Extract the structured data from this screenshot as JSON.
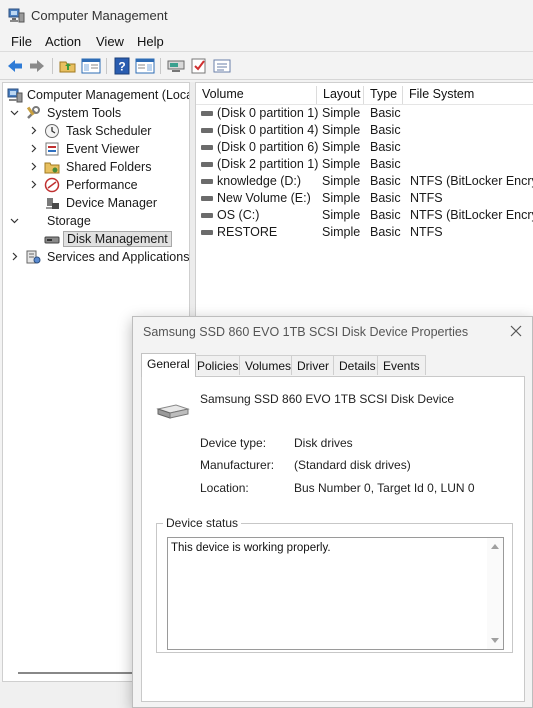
{
  "window": {
    "title": "Computer Management",
    "menu": [
      "File",
      "Action",
      "View",
      "Help"
    ]
  },
  "tree": {
    "root": "Computer Management (Local",
    "system_tools": "System Tools",
    "task_scheduler": "Task Scheduler",
    "event_viewer": "Event Viewer",
    "shared_folders": "Shared Folders",
    "performance": "Performance",
    "device_manager": "Device Manager",
    "storage": "Storage",
    "disk_management": "Disk Management",
    "services_apps": "Services and Applications"
  },
  "volumes": {
    "columns": [
      "Volume",
      "Layout",
      "Type",
      "File System"
    ],
    "rows": [
      {
        "volume": "(Disk 0 partition 1)",
        "layout": "Simple",
        "type": "Basic",
        "fs": ""
      },
      {
        "volume": "(Disk 0 partition 4)",
        "layout": "Simple",
        "type": "Basic",
        "fs": ""
      },
      {
        "volume": "(Disk 0 partition 6)",
        "layout": "Simple",
        "type": "Basic",
        "fs": ""
      },
      {
        "volume": "(Disk 2 partition 1)",
        "layout": "Simple",
        "type": "Basic",
        "fs": ""
      },
      {
        "volume": "knowledge (D:)",
        "layout": "Simple",
        "type": "Basic",
        "fs": "NTFS (BitLocker Encrypt"
      },
      {
        "volume": "New Volume (E:)",
        "layout": "Simple",
        "type": "Basic",
        "fs": "NTFS"
      },
      {
        "volume": "OS (C:)",
        "layout": "Simple",
        "type": "Basic",
        "fs": "NTFS (BitLocker Encrypt"
      },
      {
        "volume": "RESTORE",
        "layout": "Simple",
        "type": "Basic",
        "fs": "NTFS"
      }
    ]
  },
  "dialog": {
    "title": "Samsung SSD 860 EVO 1TB SCSI Disk Device Properties",
    "tabs": [
      "General",
      "Policies",
      "Volumes",
      "Driver",
      "Details",
      "Events"
    ],
    "device_name": "Samsung SSD 860 EVO 1TB SCSI Disk Device",
    "device_type_label": "Device type:",
    "device_type": "Disk drives",
    "manufacturer_label": "Manufacturer:",
    "manufacturer": "(Standard disk drives)",
    "location_label": "Location:",
    "location": "Bus Number 0, Target Id 0, LUN 0",
    "status_label": "Device status",
    "status_text": "This device is working properly."
  }
}
